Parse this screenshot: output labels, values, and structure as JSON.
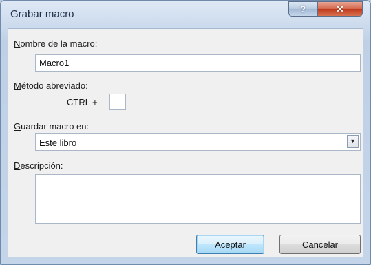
{
  "window": {
    "title": "Grabar macro",
    "help_glyph": "?",
    "close_glyph": "✕"
  },
  "form": {
    "macro_name": {
      "label_accesskey": "N",
      "label_rest": "ombre de la macro:",
      "value": "Macro1"
    },
    "shortcut": {
      "label_accesskey": "M",
      "label_rest": "étodo abreviado:",
      "prefix": "CTRL +",
      "value": ""
    },
    "store_in": {
      "label_accesskey": "G",
      "label_rest": "uardar macro en:",
      "selected": "Este libro",
      "arrow_glyph": "▼"
    },
    "description": {
      "label_accesskey": "D",
      "label_rest": "escripción:",
      "value": ""
    }
  },
  "buttons": {
    "ok": "Aceptar",
    "cancel": "Cancelar"
  },
  "colors": {
    "title_bar": "#cad9ec",
    "close_button": "#c0391b",
    "dialog_body": "#f0f0f0",
    "default_button": "#bee6fd"
  }
}
